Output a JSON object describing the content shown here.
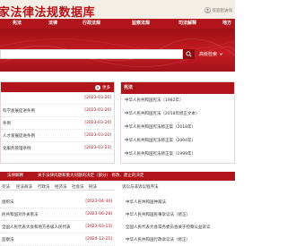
{
  "header": {
    "title": "家法律法规数据库",
    "welcome": "欢迎您访问"
  },
  "nav": [
    "宪法",
    "法律",
    "行政法规",
    "监察法规",
    "司法解释",
    "地方"
  ],
  "search": {
    "placeholder": "",
    "advanced_label": "高级检索"
  },
  "left_panel": {
    "more_label": "更多",
    "rows": [
      {
        "title": "",
        "date": "[2023-03-20]"
      },
      {
        "title": "科学发展促进条例",
        "date": "[2023-03-20]"
      },
      {
        "title": "条例",
        "date": "[2023-03-20]"
      },
      {
        "title": "人才发展促进条例",
        "date": "[2023-03-20]"
      },
      {
        "title": "化服务管理条例",
        "date": "[2023-03-23]"
      }
    ]
  },
  "right_panel": {
    "title": "宪法",
    "rows": [
      "中华人民共和国宪法（1982年）",
      "中华人民共和国宪法（2018年修正文本）",
      "中华人民共和国宪法修正案（2018年）",
      "中华人民共和国宪法修正案（2004年）",
      "中华人民共和国宪法修正案（1999年）"
    ]
  },
  "section_bar": {
    "label": "法律解释",
    "text": "关于法律问题和重大问题的决定（部分） 修改、废止的决定"
  },
  "bottom_tabs": [
    "宪法",
    "民法商法",
    "行政法",
    "经济法",
    "社会法",
    "刑法"
  ],
  "bottom_left_rows": [
    {
      "title": "组织法",
      "date": "[2023-04-30]"
    },
    {
      "title": "民共和国对外关系法",
      "date": "[2023-06-28]"
    },
    {
      "title": "全国人民代表大会和地方各级人民代表",
      "date": "[2023-03-13]"
    },
    {
      "title": "监察法",
      "date": "[2024-12-25]"
    }
  ],
  "bottom_right": {
    "title": "诉讼与非诉讼程序法",
    "rows": [
      "中华人民共和国仲裁法",
      "中华人民共和国民事诉讼法（修正）",
      "全国人民代表大会常务委员会关于检察公益诉讼",
      "中华人民共和国行政诉讼法（修正）"
    ]
  },
  "colors": {
    "brand_red": "#b0151b",
    "dark_red": "#8c0d12",
    "header_bg": "#f4efe6",
    "date_red": "#b0151b"
  },
  "icons": [
    "user-icon",
    "search-icon",
    "chevron-down-icon",
    "more-arrow-icon"
  ]
}
